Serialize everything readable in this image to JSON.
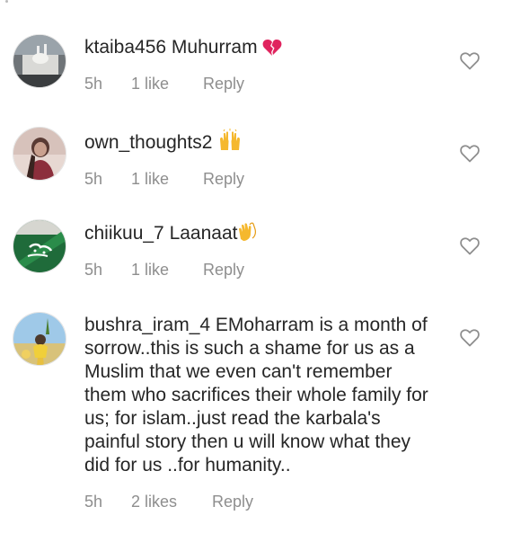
{
  "comments": [
    {
      "username": "ktaiba456",
      "text": " Muhurram ",
      "emoji": "broken-heart-icon",
      "time": "5h",
      "likes": "1 like",
      "reply": "Reply"
    },
    {
      "username": "own_thoughts2",
      "text": " ",
      "emoji": "raising-hands-icon",
      "time": "5h",
      "likes": "1 like",
      "reply": "Reply"
    },
    {
      "username": "chiikuu_7",
      "text": " Laanaat",
      "emoji": "clapping-hands-icon",
      "time": "5h",
      "likes": "1 like",
      "reply": "Reply"
    },
    {
      "username": "bushra_iram_4",
      "text": " EMoharram is a month of sorrow..this is such a shame for us as a Muslim that we even can't remember them who sacrifices their whole family for us; for islam..just read the karbala's painful story then u will know what they did for us ..for humanity..",
      "time": "5h",
      "likes": "2 likes",
      "reply": "Reply"
    }
  ],
  "colors": {
    "text": "#262626",
    "meta": "#8e8e8e",
    "heart_outline": "#8e8e8e",
    "broken_heart": "#e0245e",
    "hands": "#f5b82e"
  }
}
